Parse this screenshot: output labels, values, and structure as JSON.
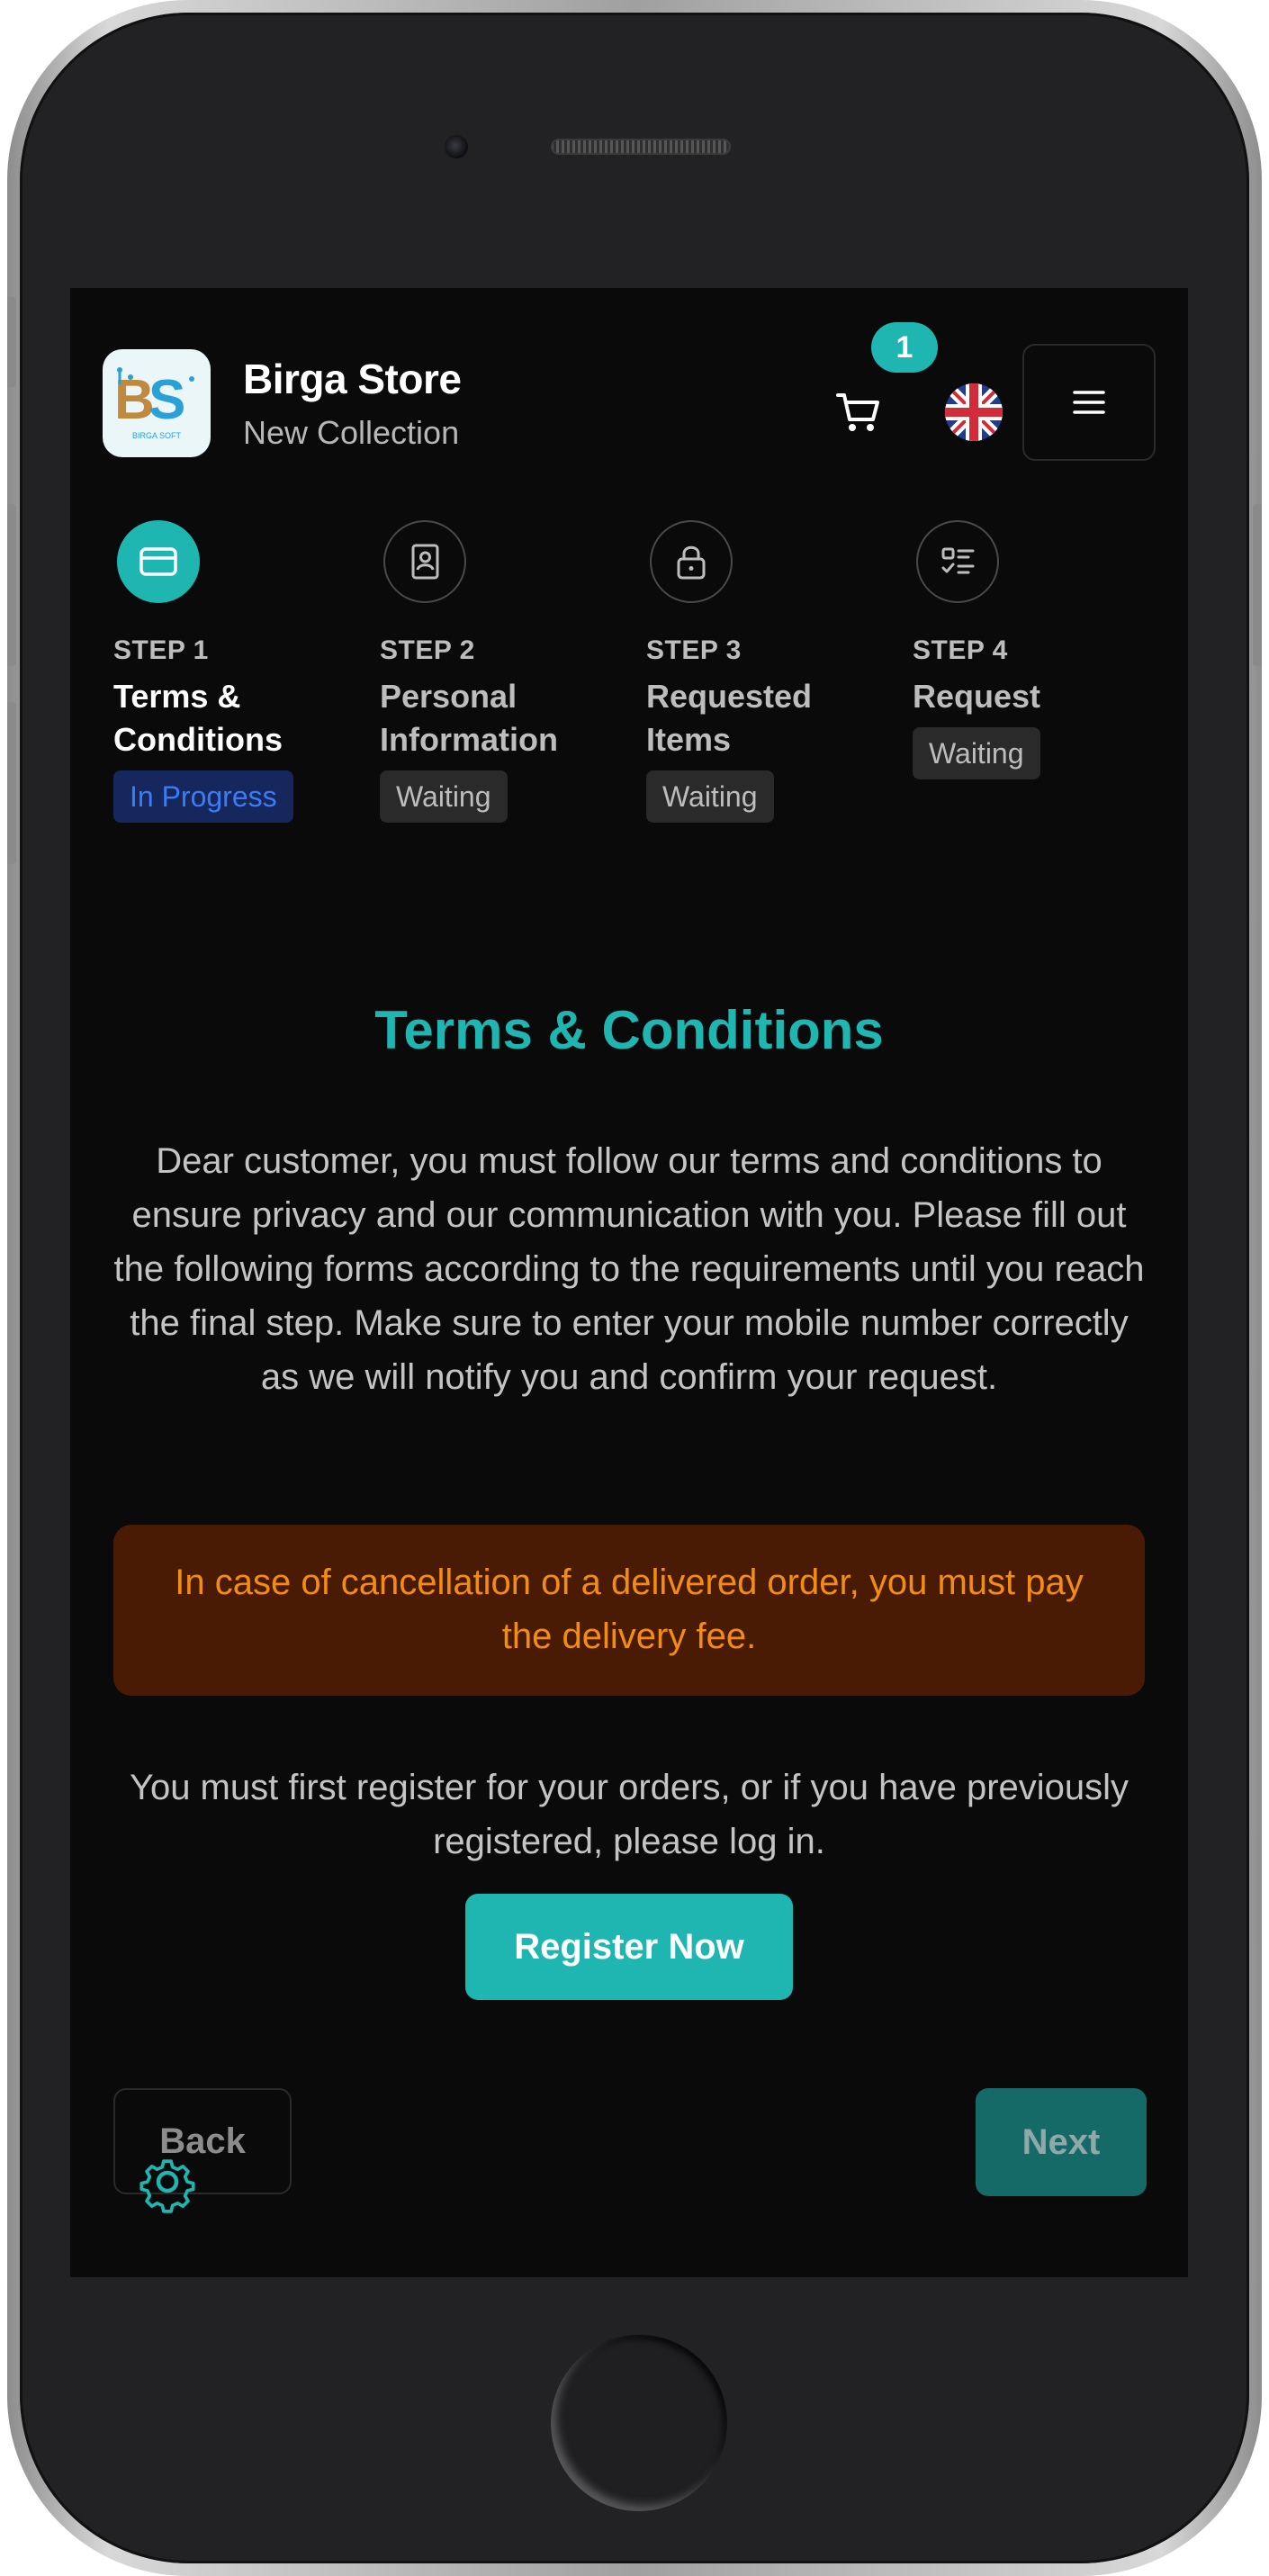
{
  "header": {
    "store_name": "Birga Store",
    "store_subtitle": "New Collection",
    "cart_count": "1",
    "language_icon": "uk-flag-icon",
    "menu_icon": "hamburger-menu-icon",
    "logo_text": "BS",
    "logo_caption": "BIRGA SOFT"
  },
  "steps": [
    {
      "number": "STEP 1",
      "title": "Terms & Conditions",
      "status": "In Progress",
      "icon": "credit-card-icon"
    },
    {
      "number": "STEP 2",
      "title": "Personal Information",
      "status": "Waiting",
      "icon": "contact-card-icon"
    },
    {
      "number": "STEP 3",
      "title": "Requested Items",
      "status": "Waiting",
      "icon": "lock-icon"
    },
    {
      "number": "STEP 4",
      "title": "Request",
      "status": "Waiting",
      "icon": "checklist-icon"
    }
  ],
  "content": {
    "title": "Terms & Conditions",
    "intro": "Dear customer, you must follow our terms and conditions to ensure privacy and our communication with you. Please fill out the following forms according to the requirements until you reach the final step. Make sure to enter your mobile number correctly as we will notify you and confirm your request.",
    "warning": "In case of cancellation of a delivered order, you must pay the delivery fee.",
    "register_text": "You must first register for your orders, or if you have previously registered, please log in.",
    "register_label": "Register Now"
  },
  "nav": {
    "back_label": "Back",
    "next_label": "Next"
  },
  "colors": {
    "accent": "#1fb5b0",
    "background": "#0a0a0a",
    "warning_bg": "#4a1b04",
    "warning_text": "#f28d12",
    "progress_badge": "#3a7cf5"
  }
}
